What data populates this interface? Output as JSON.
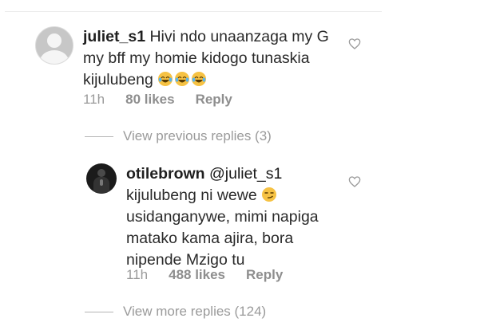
{
  "comment1": {
    "username": "juliet_s1",
    "text_line1": "Hivi ndo unaanzaga my G",
    "text_line2": "my bff my homie kidogo tunaskia",
    "text_line3": "kijulubeng",
    "emojis": [
      "laughing-crying-emoji",
      "laughing-crying-emoji",
      "laughing-crying-emoji"
    ],
    "time": "11h",
    "likes": "80 likes",
    "reply": "Reply"
  },
  "view_previous": "View previous replies (3)",
  "comment2": {
    "username": "otilebrown",
    "mention": "@juliet_s1",
    "text_line1": "kijulubeng ni wewe",
    "emoji": "smirk-emoji",
    "text_line2": "usidanganywe, mimi napiga",
    "text_line3": "matako kama ajira, bora",
    "text_line4": "nipende Mzigo tu",
    "time": "11h",
    "likes": "488 likes",
    "reply": "Reply"
  },
  "view_more": "View more replies (124)",
  "colors": {
    "text": "#262626",
    "meta": "#9a9a9a",
    "emoji": "#f6c244"
  }
}
